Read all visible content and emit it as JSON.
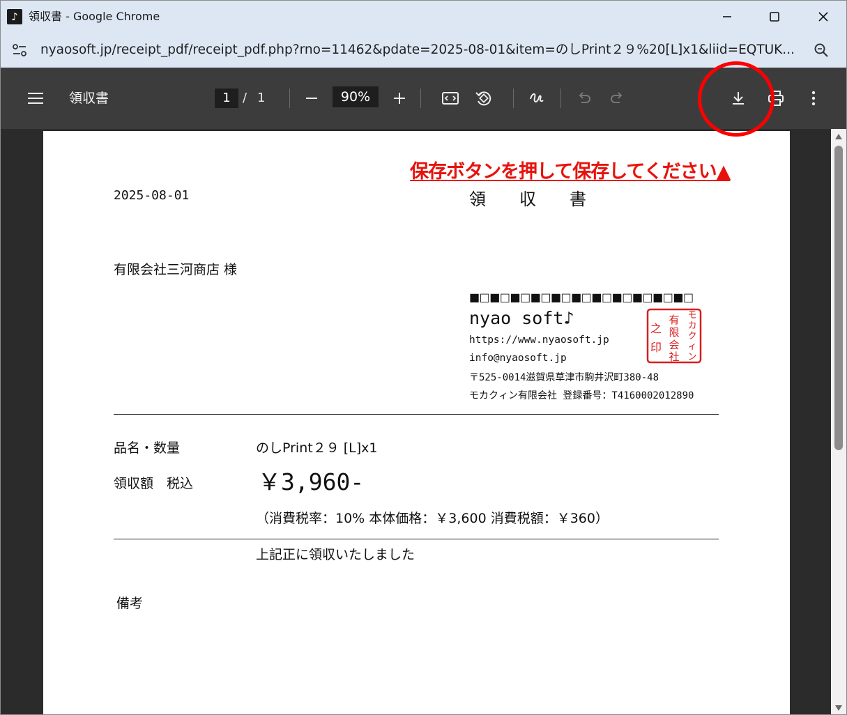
{
  "window": {
    "title": "領収書 - Google Chrome",
    "app_icon": "♪",
    "minimize_icon": "minimize-icon",
    "maximize_icon": "maximize-icon",
    "close_icon": "close-icon"
  },
  "address_bar": {
    "url": "nyaosoft.jp/receipt_pdf/receipt_pdf.php?rno=11462&pdate=2025-08-01&item=のしPrint２９%20[L]x1&liid=EQTUK..."
  },
  "pdf_toolbar": {
    "title": "領収書",
    "current_page": "1",
    "page_separator": "/",
    "total_pages": "1",
    "zoom": "90%"
  },
  "receipt": {
    "notice": "保存ボタンを押して保存してください▲",
    "date": "2025-08-01",
    "heading": "領　　収　　書",
    "customer": "有限会社三河商店 様",
    "pattern": "■□■□■□■□■□■□■□■□■□■□■□",
    "company_name": "nyao soft♪",
    "website": "https://www.nyaosoft.jp",
    "email": "info@nyaosoft.jp",
    "address": "〒525-0014滋賀県草津市駒井沢町380-48",
    "registration": "モカクィン有限会社 登録番号：T4160002012890",
    "item_label": "品名・数量",
    "item_value": "のしPrint２９ [L]x1",
    "amount_label": "領収額　税込",
    "amount_value": "￥3,960-",
    "tax_detail": "（消費税率：10% 本体価格：￥3,600 消費税額：￥360）",
    "received_text": "上記正に領収いたしました",
    "remarks_label": "備考",
    "seal_text": "モカクィン有限会社之印"
  },
  "colors": {
    "notice": "#e8120c",
    "seal": "#d81e1e",
    "annotation_circle": "#ff0000",
    "toolbar_bg": "#3c3c3c"
  }
}
